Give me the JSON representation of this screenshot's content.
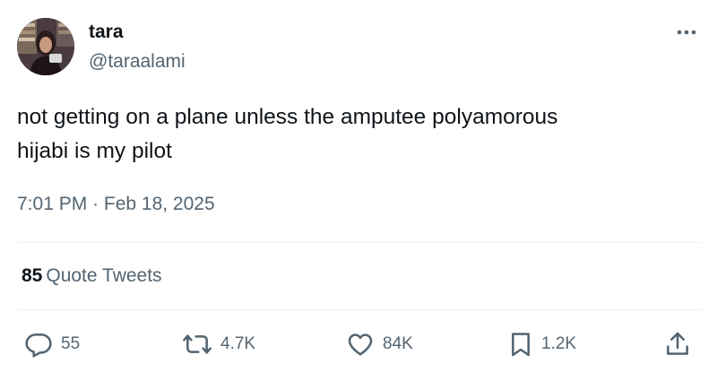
{
  "author": {
    "name": "tara",
    "handle": "@taraalami"
  },
  "tweet": {
    "text_line1": "not getting on a plane unless the amputee polyamorous",
    "text_line2": "hijabi is my pilot",
    "timestamp": "7:01 PM · Feb 18, 2025"
  },
  "stats": {
    "quote_count": "85",
    "quote_label": "Quote Tweets"
  },
  "actions": {
    "replies": "55",
    "retweets": "4.7K",
    "likes": "84K",
    "bookmarks": "1.2K"
  },
  "icons": {
    "more": "more-horizontal-icon",
    "reply": "reply-icon",
    "retweet": "retweet-icon",
    "like": "heart-icon",
    "bookmark": "bookmark-icon",
    "share": "share-icon"
  },
  "colors": {
    "text_primary": "#0f1419",
    "text_secondary": "#536471",
    "divider": "#eff3f4"
  }
}
